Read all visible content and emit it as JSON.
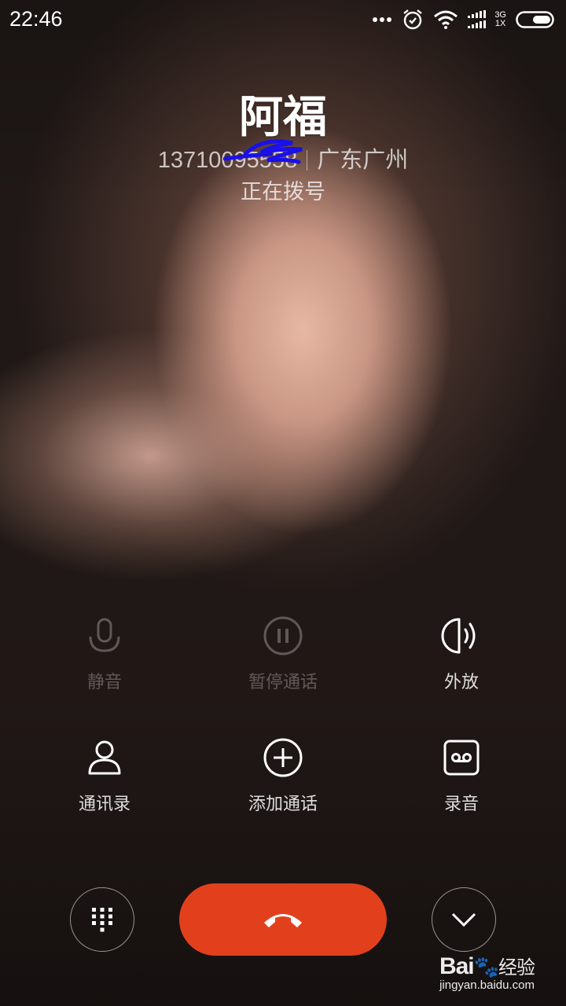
{
  "status_bar": {
    "time": "22:46",
    "network_top": "3G",
    "network_bottom": "1X",
    "icons": [
      "more-dots-icon",
      "alarm-icon",
      "wifi-icon",
      "signal-icon",
      "battery-icon"
    ]
  },
  "caller": {
    "name": "阿福",
    "number": "13710095558",
    "location": "广东广州",
    "status": "正在拨号"
  },
  "actions": [
    {
      "label": "静音",
      "icon": "microphone-icon",
      "enabled": false
    },
    {
      "label": "暂停通话",
      "icon": "pause-icon",
      "enabled": false
    },
    {
      "label": "外放",
      "icon": "speaker-icon",
      "enabled": true
    },
    {
      "label": "通讯录",
      "icon": "contact-icon",
      "enabled": true
    },
    {
      "label": "添加通话",
      "icon": "add-call-icon",
      "enabled": true
    },
    {
      "label": "录音",
      "icon": "record-icon",
      "enabled": true
    }
  ],
  "controls": {
    "dialpad_icon": "dialpad-icon",
    "end_call_icon": "end-call-icon",
    "collapse_icon": "chevron-down-icon",
    "end_call_color": "#e2401c"
  },
  "watermark": {
    "brand": "Bai",
    "brand_suffix": "经验",
    "url": "jingyan.baidu.com"
  }
}
